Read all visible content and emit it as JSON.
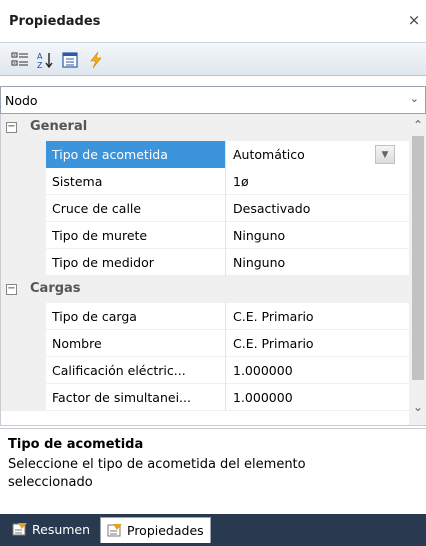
{
  "window": {
    "title": "Propiedades",
    "close_glyph": "×"
  },
  "toolbar": {
    "buttons": [
      {
        "name": "categorized-view-icon"
      },
      {
        "name": "alphabetical-sort-icon"
      },
      {
        "name": "property-pages-icon"
      },
      {
        "name": "events-lightning-icon"
      }
    ]
  },
  "object_selector": {
    "value": "Nodo",
    "arrow": "⌄"
  },
  "grid": {
    "categories": [
      {
        "label": "General",
        "expander": "−",
        "rows": [
          {
            "name": "Tipo de acometida",
            "value": "Automático",
            "selected": true
          },
          {
            "name": "Sistema",
            "value": "1ø"
          },
          {
            "name": "Cruce de calle",
            "value": "Desactivado"
          },
          {
            "name": "Tipo de murete",
            "value": "Ninguno"
          },
          {
            "name": "Tipo de medidor",
            "value": "Ninguno"
          }
        ]
      },
      {
        "label": "Cargas",
        "expander": "−",
        "rows": [
          {
            "name": "Tipo de carga",
            "value": "C.E. Primario"
          },
          {
            "name": "Nombre",
            "value": "C.E. Primario"
          },
          {
            "name": "Calificación eléctric...",
            "value": "1.000000"
          },
          {
            "name": "Factor de simultanei...",
            "value": "1.000000"
          }
        ]
      }
    ],
    "dropdown_glyph": "▼",
    "scroll_up": "⌃",
    "scroll_down": "⌄"
  },
  "description": {
    "title": "Tipo de acometida",
    "text": "Seleccione el tipo de acometida del elemento seleccionado"
  },
  "tabs": [
    {
      "label": "Resumen",
      "active": false
    },
    {
      "label": "Propiedades",
      "active": true
    }
  ],
  "colors": {
    "selection": "#3c94dc",
    "tabbar": "#293a50",
    "toolbar_top": "#f4f7fb",
    "toolbar_bottom": "#dfe6ee",
    "lightning": "#f2b01e"
  }
}
